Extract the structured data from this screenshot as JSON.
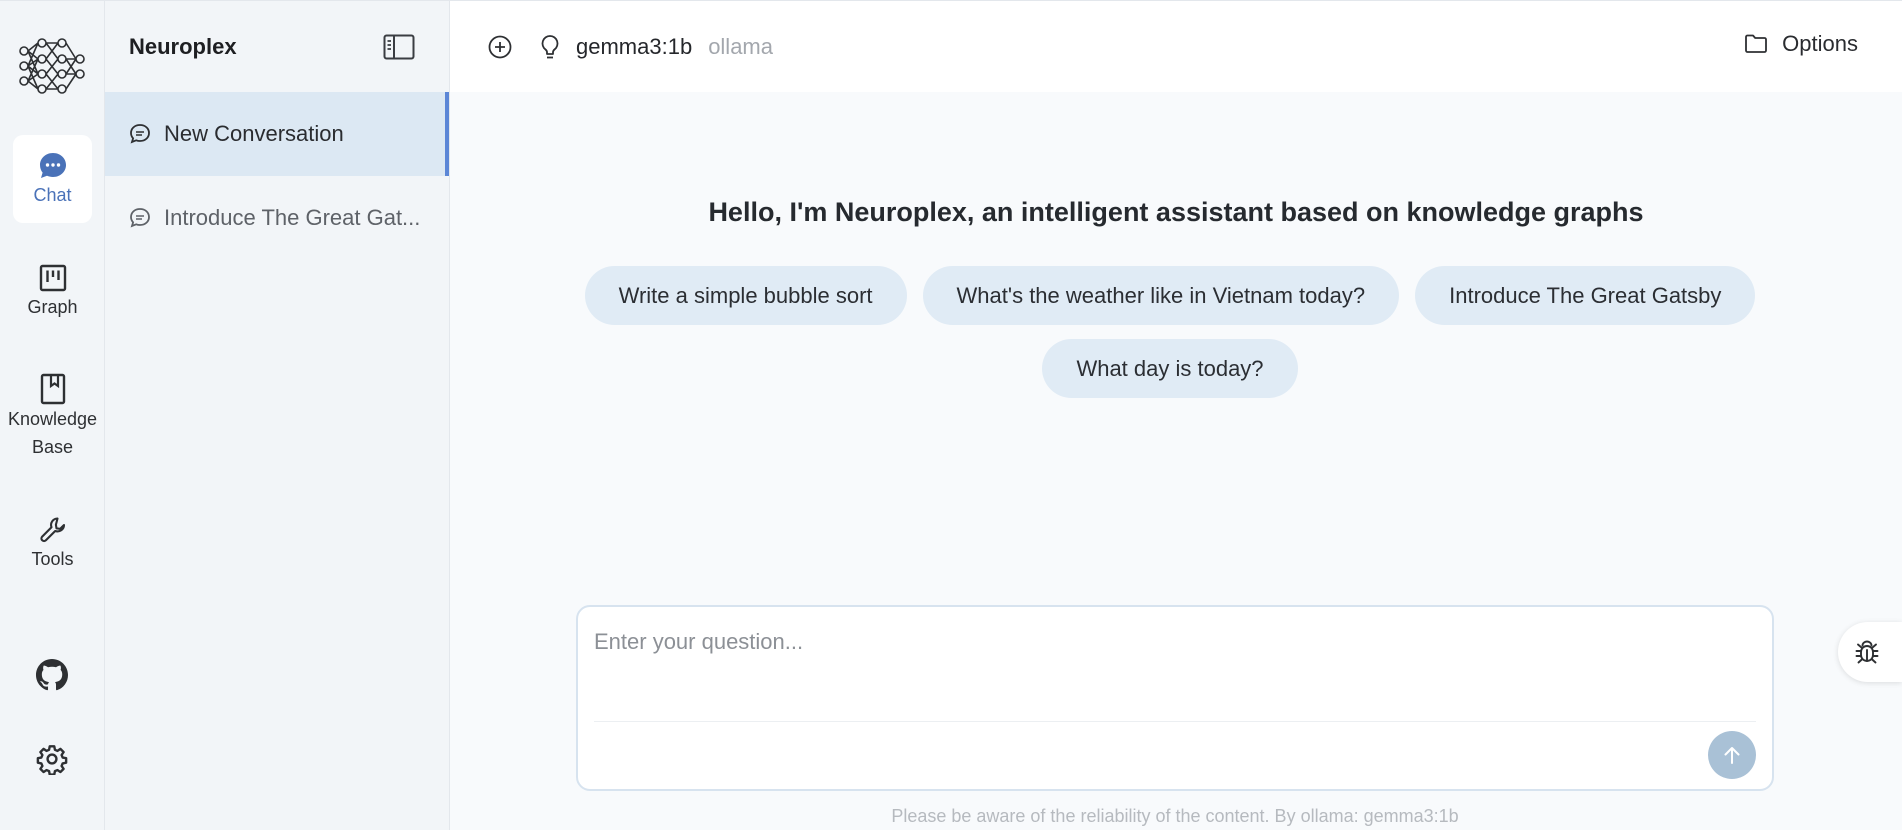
{
  "app": {
    "name": "Neuroplex"
  },
  "nav": {
    "items": [
      {
        "label": "Chat",
        "icon": "chat-bubble-icon",
        "active": true
      },
      {
        "label": "Graph",
        "icon": "graph-board-icon",
        "active": false
      },
      {
        "label": "Knowledge Base",
        "icon": "book-icon",
        "active": false
      },
      {
        "label": "Tools",
        "icon": "wrench-icon",
        "active": false
      }
    ],
    "bottom": [
      {
        "icon": "github-icon"
      },
      {
        "icon": "gear-icon"
      }
    ]
  },
  "sidebar": {
    "title": "Neuroplex",
    "conversations": [
      {
        "title": "New Conversation",
        "active": true
      },
      {
        "title": "Introduce The Great Gat...",
        "active": false
      }
    ]
  },
  "topbar": {
    "model": "gemma3:1b",
    "provider": "ollama",
    "options_label": "Options"
  },
  "main": {
    "greeting": "Hello, I'm Neuroplex, an intelligent assistant based on knowledge graphs",
    "suggestions": [
      "Write a simple bubble sort",
      "What's the weather like in Vietnam today?",
      "Introduce The Great Gatsby",
      "What day is today?"
    ],
    "input": {
      "placeholder": "Enter your question...",
      "value": ""
    },
    "disclaimer": "Please be aware of the reliability of the content. By ollama: gemma3:1b"
  },
  "colors": {
    "accent": "#5b86d6",
    "active_nav": "#4a72b8",
    "chip_bg": "#e0ebf5",
    "send_button": "#a9c1d6"
  }
}
